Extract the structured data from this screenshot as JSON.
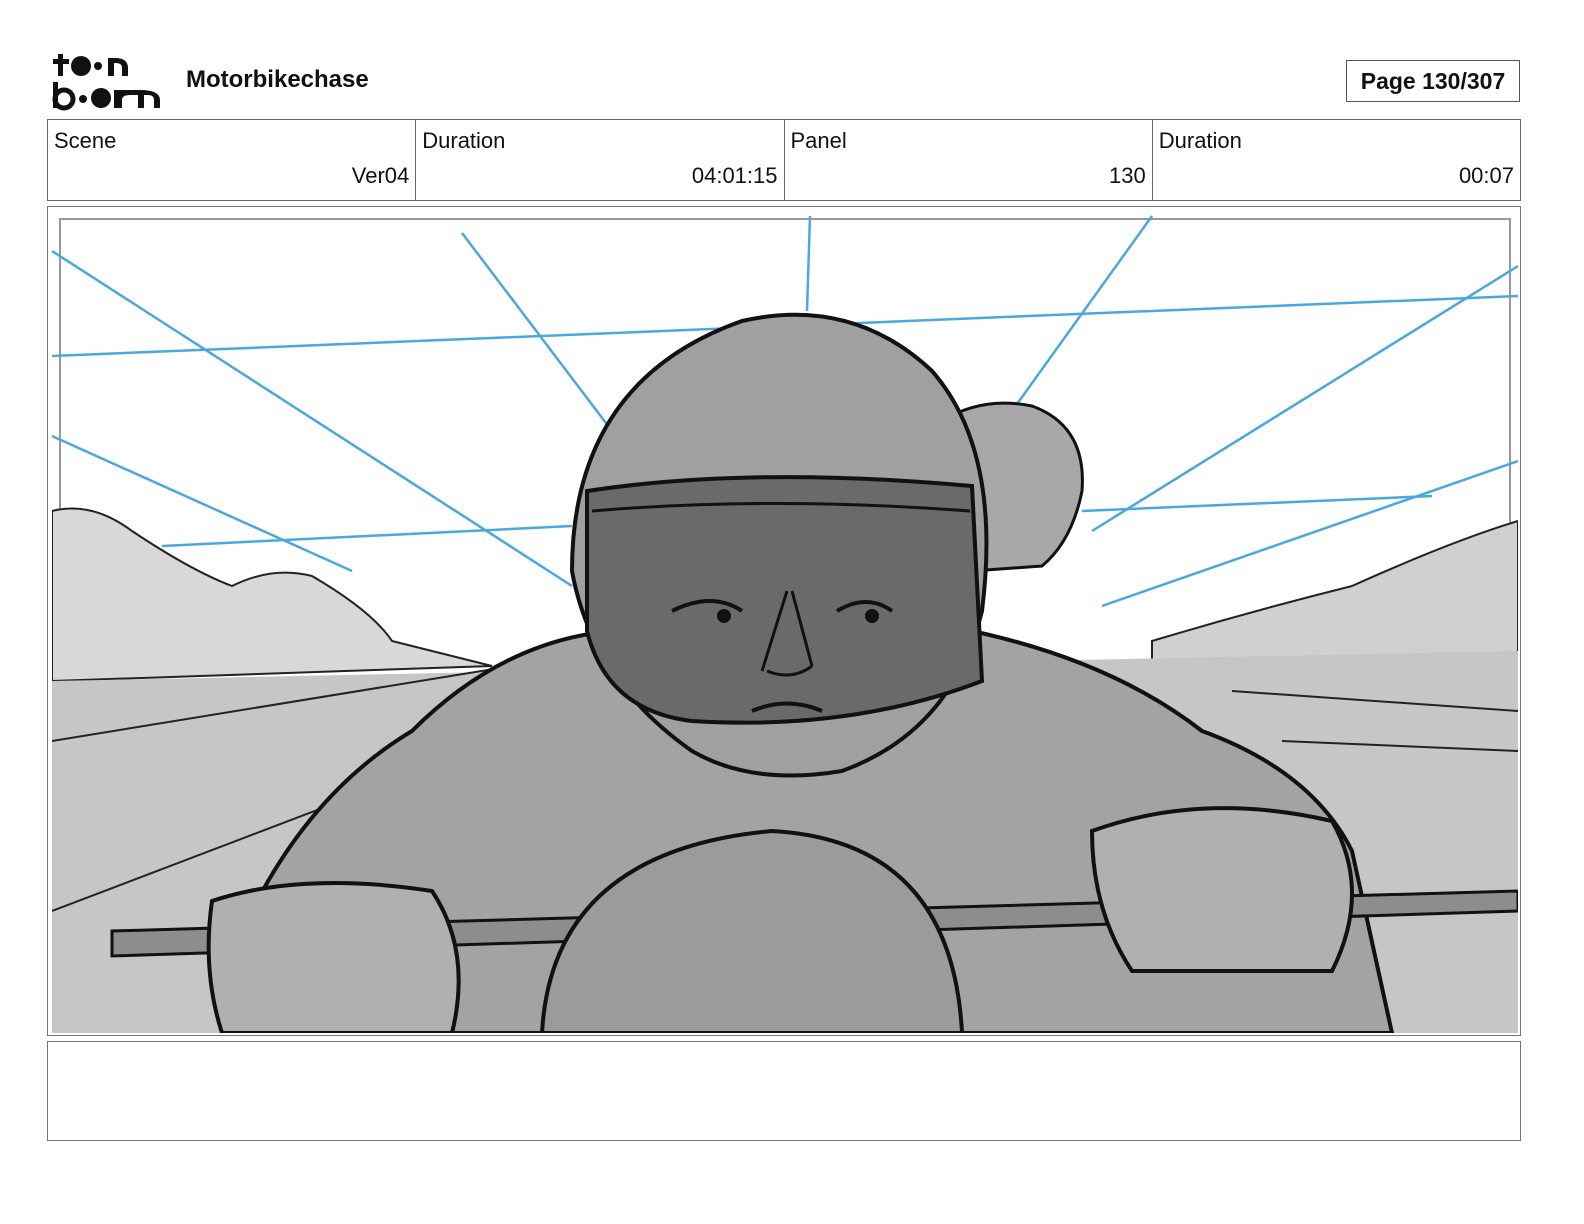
{
  "header": {
    "logo_text": "toon boom",
    "project_title": "Motorbikechase",
    "page_label": "Page 130/307"
  },
  "info": {
    "scene_label": "Scene",
    "scene_value": "Ver04",
    "duration_label": "Duration",
    "duration_value": "04:01:15",
    "panel_label": "Panel",
    "panel_value": "130",
    "panel_duration_label": "Duration",
    "panel_duration_value": "00:07"
  },
  "notes": {
    "text": ""
  },
  "colors": {
    "guide_lines": "#4aa8dc",
    "sketch_ink": "#111111",
    "grey_fill": "#9e9e9e"
  }
}
